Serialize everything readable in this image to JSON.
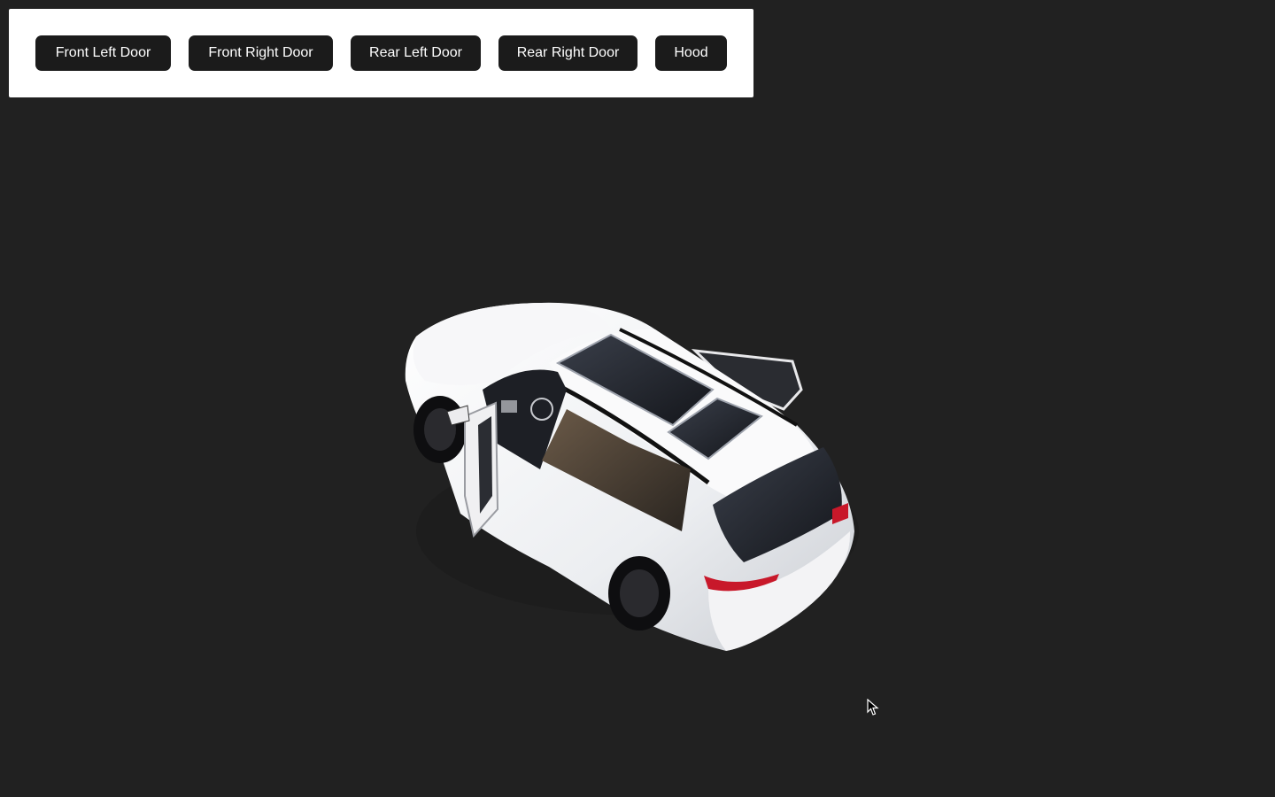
{
  "controls": {
    "front_left_door": "Front Left Door",
    "front_right_door": "Front Right Door",
    "rear_left_door": "Rear Left Door",
    "rear_right_door": "Rear Right Door",
    "hood": "Hood"
  },
  "scene": {
    "background": "#212121",
    "car_color": "#f2f2f4",
    "glass_color": "#1a1d24"
  },
  "cursor": {
    "icon": "arrow-cursor-icon"
  }
}
